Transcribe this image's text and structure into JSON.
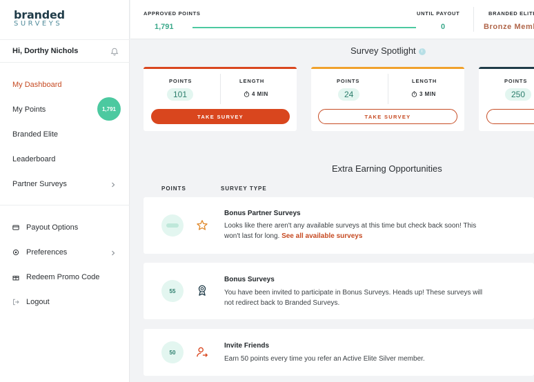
{
  "logo": {
    "line1": "branded",
    "line2": "SURVEYS"
  },
  "user": {
    "greeting": "Hi, Dorthy Nichols"
  },
  "sidebar": {
    "items": [
      {
        "label": "My Dashboard"
      },
      {
        "label": "My Points",
        "badge": "1,791"
      },
      {
        "label": "Branded Elite"
      },
      {
        "label": "Leaderboard"
      },
      {
        "label": "Partner Surveys"
      }
    ],
    "secondary": [
      {
        "label": "Payout Options",
        "icon": "wallet-icon"
      },
      {
        "label": "Preferences",
        "icon": "gear-icon"
      },
      {
        "label": "Redeem Promo Code",
        "icon": "gift-icon"
      },
      {
        "label": "Logout",
        "icon": "logout-icon"
      }
    ]
  },
  "topbar": {
    "approved_label": "APPROVED POINTS",
    "approved_value": "1,791",
    "until_label": "UNTIL PAYOUT",
    "until_value": "0",
    "progress_fraction": 1.0,
    "elite_label": "BRANDED ELITE",
    "elite_value": "Bronze Member"
  },
  "spotlight": {
    "title": "Survey Spotlight",
    "points_label": "POINTS",
    "length_label": "LENGTH",
    "cards": [
      {
        "points": "101",
        "length": "4 MIN",
        "button": "TAKE SURVEY",
        "accent": "#d9461e",
        "style": "solid"
      },
      {
        "points": "24",
        "length": "3 MIN",
        "button": "TAKE SURVEY",
        "accent": "#f0a12c",
        "style": "outline"
      },
      {
        "points": "250",
        "length": "",
        "button": "",
        "accent": "#1f3b48",
        "style": "outline"
      }
    ]
  },
  "extra": {
    "title": "Extra Earning Opportunities",
    "col_points": "POINTS",
    "col_type": "SURVEY TYPE",
    "rows": [
      {
        "points": "",
        "icon": "star-icon",
        "title": "Bonus Partner Surveys",
        "desc": "Looks like there aren't any available surveys at this time but check back soon! This won't last for long.",
        "link": "See all available surveys"
      },
      {
        "points": "55",
        "icon": "ribbon-icon",
        "title": "Bonus Surveys",
        "desc": "You have been invited to participate in Bonus Surveys. Heads up! These surveys will not redirect back to Branded Surveys.",
        "link": ""
      },
      {
        "points": "50",
        "icon": "invite-user-icon",
        "title": "Invite Friends",
        "desc": "Earn 50 points every time you refer an Active Elite Silver member.",
        "link": ""
      }
    ]
  },
  "colors": {
    "accent": "#d9461e",
    "teal": "#4cc9a0",
    "navy": "#1f3b48"
  }
}
